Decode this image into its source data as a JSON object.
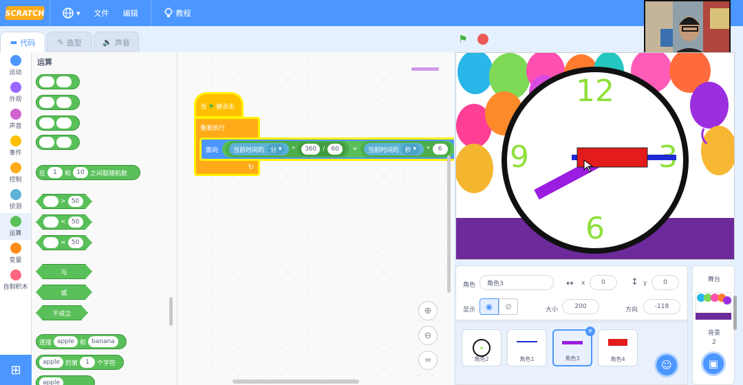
{
  "menubar": {
    "logo": "SCRATCH",
    "file": "文件",
    "edit": "编辑",
    "tutorials": "教程"
  },
  "tabs": [
    {
      "label": "代码"
    },
    {
      "label": "造型"
    },
    {
      "label": "声音"
    }
  ],
  "categories": [
    {
      "label": "运动",
      "color": "#4c97ff"
    },
    {
      "label": "外观",
      "color": "#9966ff"
    },
    {
      "label": "声音",
      "color": "#cf63cf"
    },
    {
      "label": "事件",
      "color": "#ffbf00"
    },
    {
      "label": "控制",
      "color": "#ffab19"
    },
    {
      "label": "侦测",
      "color": "#5cb1d6"
    },
    {
      "label": "运算",
      "color": "#59c059"
    },
    {
      "label": "变量",
      "color": "#ff8c1a"
    },
    {
      "label": "自制积木",
      "color": "#ff6680"
    }
  ],
  "palette": {
    "title": "运算",
    "random": {
      "from": "在",
      "a": "1",
      "to": "和",
      "b": "10",
      "suffix": "之间取随机数"
    },
    "gt": {
      "op": ">",
      "val": "50"
    },
    "lt": {
      "op": "<",
      "val": "50"
    },
    "eq": {
      "op": "=",
      "val": "50"
    },
    "and": "与",
    "or": "或",
    "not": "不成立",
    "join": {
      "label": "连接",
      "a": "apple",
      "b": "和",
      "c": "banana"
    },
    "letter": {
      "a": "apple",
      "b": "的第",
      "n": "1",
      "c": "个字符"
    },
    "cut": "apple"
  },
  "script": {
    "hat": "当",
    "hat_suffix": "被点击",
    "loop": "重复执行",
    "motion": "面向",
    "sensing1": "当前时间的",
    "dd1": "分",
    "n360": "360",
    "slash": "/",
    "n60": "60",
    "plus": "+",
    "sensing2": "当前时间的",
    "dd2": "秒",
    "star": "*",
    "n6": "6"
  },
  "stage": {
    "n12": "12",
    "n3": "3",
    "n6": "6",
    "n9": "9",
    "colors": {
      "ring": "#111111",
      "hand_red": "#e31b1b",
      "hand_purple": "#9b1de0",
      "numbers": "#8ee03a",
      "floor": "#6c2a9a"
    }
  },
  "sprite_info": {
    "sprite_label": "角色",
    "sprite_name": "角色3",
    "x_label": "x",
    "x": "0",
    "y_label": "y",
    "y": "0",
    "show_label": "显示",
    "size_label": "大小",
    "size": "200",
    "direction_label": "方向",
    "direction": "-118"
  },
  "sprites": [
    {
      "name": "角色2"
    },
    {
      "name": "角色1"
    },
    {
      "name": "角色3"
    },
    {
      "name": "角色4"
    }
  ],
  "stage_panel": {
    "title": "舞台",
    "backdrops_label": "背景",
    "backdrops_count": "2"
  }
}
